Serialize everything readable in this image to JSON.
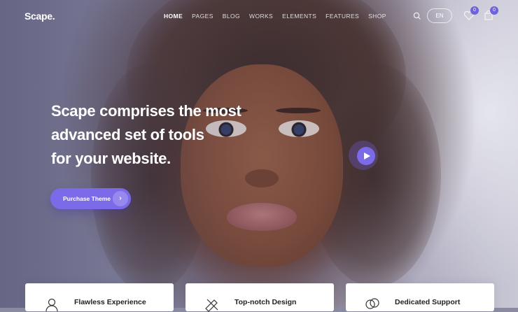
{
  "brand": {
    "logo": "Scape.",
    "accent_color": "#7c6be8"
  },
  "nav": {
    "items": [
      {
        "label": "HOME",
        "active": true
      },
      {
        "label": "PAGES",
        "active": false
      },
      {
        "label": "BLOG",
        "active": false
      },
      {
        "label": "WORKS",
        "active": false
      },
      {
        "label": "ELEMENTS",
        "active": false
      },
      {
        "label": "FEATURES",
        "active": false
      },
      {
        "label": "SHOP",
        "active": false
      }
    ],
    "search_icon": "search-icon",
    "language": "EN",
    "wishlist_count": "0",
    "cart_count": "0"
  },
  "hero": {
    "headline_lines": [
      "Scape comprises the most",
      "advanced set of tools",
      "for your website."
    ],
    "cta_label": "Purchase Theme",
    "cta_icon": "chevron-right-icon",
    "play_icon": "play-icon"
  },
  "features": [
    {
      "title": "Flawless Experience",
      "icon": "user-icon"
    },
    {
      "title": "Top-notch Design",
      "icon": "ruler-pencil-icon"
    },
    {
      "title": "Dedicated Support",
      "icon": "chat-icon"
    }
  ]
}
